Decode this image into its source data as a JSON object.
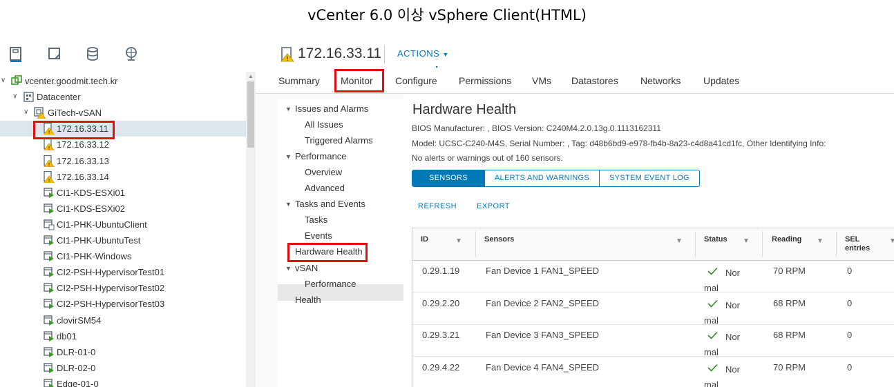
{
  "caption": "vCenter 6.0 이상 vSphere Client(HTML)",
  "navigator": {
    "icons": [
      "hosts-clusters-icon",
      "vms-templates-icon",
      "storage-icon",
      "networking-icon"
    ],
    "tree": [
      {
        "label": "vcenter.goodmit.tech.kr",
        "level": 0,
        "icon": "vcenter-icon",
        "expanded": true
      },
      {
        "label": "Datacenter",
        "level": 1,
        "icon": "datacenter-icon",
        "expanded": true
      },
      {
        "label": "GiTech-vSAN",
        "level": 2,
        "icon": "cluster-warning-icon",
        "expanded": true
      },
      {
        "label": "172.16.33.11",
        "level": 3,
        "icon": "host-warning-icon",
        "selected": true
      },
      {
        "label": "172.16.33.12",
        "level": 3,
        "icon": "host-warning-icon"
      },
      {
        "label": "172.16.33.13",
        "level": 3,
        "icon": "host-warning-icon"
      },
      {
        "label": "172.16.33.14",
        "level": 3,
        "icon": "host-warning-icon"
      },
      {
        "label": "CI1-KDS-ESXi01",
        "level": 3,
        "icon": "vm-on-icon"
      },
      {
        "label": "CI1-KDS-ESXi02",
        "level": 3,
        "icon": "vm-on-icon"
      },
      {
        "label": "CI1-PHK-UbuntuClient",
        "level": 3,
        "icon": "vm-off-icon"
      },
      {
        "label": "CI1-PHK-UbuntuTest",
        "level": 3,
        "icon": "vm-on-icon"
      },
      {
        "label": "CI1-PHK-Windows",
        "level": 3,
        "icon": "vm-on-icon"
      },
      {
        "label": "CI2-PSH-HypervisorTest01",
        "level": 3,
        "icon": "vm-on-icon"
      },
      {
        "label": "CI2-PSH-HypervisorTest02",
        "level": 3,
        "icon": "vm-on-icon"
      },
      {
        "label": "CI2-PSH-HypervisorTest03",
        "level": 3,
        "icon": "vm-on-icon"
      },
      {
        "label": "clovirSM54",
        "level": 3,
        "icon": "vm-on-icon"
      },
      {
        "label": "db01",
        "level": 3,
        "icon": "vm-on-icon"
      },
      {
        "label": "DLR-01-0",
        "level": 3,
        "icon": "vm-on-icon"
      },
      {
        "label": "DLR-02-0",
        "level": 3,
        "icon": "vm-on-icon"
      },
      {
        "label": "Edge-01-0",
        "level": 3,
        "icon": "vm-on-icon"
      }
    ]
  },
  "header": {
    "title": "172.16.33.11",
    "actions_label": "ACTIONS"
  },
  "tabs": [
    "Summary",
    "Monitor",
    "Configure",
    "Permissions",
    "VMs",
    "Datastores",
    "Networks",
    "Updates"
  ],
  "active_tab": "Monitor",
  "subnav": {
    "issues": {
      "label": "Issues and Alarms",
      "items": [
        "All Issues",
        "Triggered Alarms"
      ]
    },
    "performance": {
      "label": "Performance",
      "items": [
        "Overview",
        "Advanced"
      ]
    },
    "tasks": {
      "label": "Tasks and Events",
      "items": [
        "Tasks",
        "Events"
      ]
    },
    "hardware_health": "Hardware Health",
    "vsan": {
      "label": "vSAN",
      "items": [
        "Performance"
      ]
    },
    "health": "Health"
  },
  "content": {
    "title": "Hardware Health",
    "bios_line": "BIOS Manufacturer: , BIOS Version: C240M4.2.0.13g.0.1113162311",
    "model_line": "Model: UCSC-C240-M4S, Serial Number: , Tag: d48b6bd9-e978-fb4b-8a23-c4d8a41cd1fc, Other Identifying Info:",
    "summary_line": "No alerts or warnings out of 160 sensors.",
    "view_buttons": [
      "SENSORS",
      "ALERTS AND WARNINGS",
      "SYSTEM EVENT LOG"
    ],
    "refresh_label": "REFRESH",
    "export_label": "EXPORT",
    "columns": [
      "ID",
      "Sensors",
      "Status",
      "Reading",
      "SEL entries"
    ],
    "rows": [
      {
        "id": "0.29.1.19",
        "sensor": "Fan Device 1 FAN1_SPEED",
        "status": "Normal",
        "reading": "70 RPM",
        "sel": "0"
      },
      {
        "id": "0.29.2.20",
        "sensor": "Fan Device 2 FAN2_SPEED",
        "status": "Normal",
        "reading": "68 RPM",
        "sel": "0"
      },
      {
        "id": "0.29.3.21",
        "sensor": "Fan Device 3 FAN3_SPEED",
        "status": "Normal",
        "reading": "68 RPM",
        "sel": "0"
      },
      {
        "id": "0.29.4.22",
        "sensor": "Fan Device 4 FAN4_SPEED",
        "status": "Normal",
        "reading": "70 RPM",
        "sel": "0"
      }
    ]
  },
  "colors": {
    "accent": "#0079b8",
    "highlight": "#e01010",
    "ok": "#2e8b22",
    "warning": "#f6c000"
  }
}
